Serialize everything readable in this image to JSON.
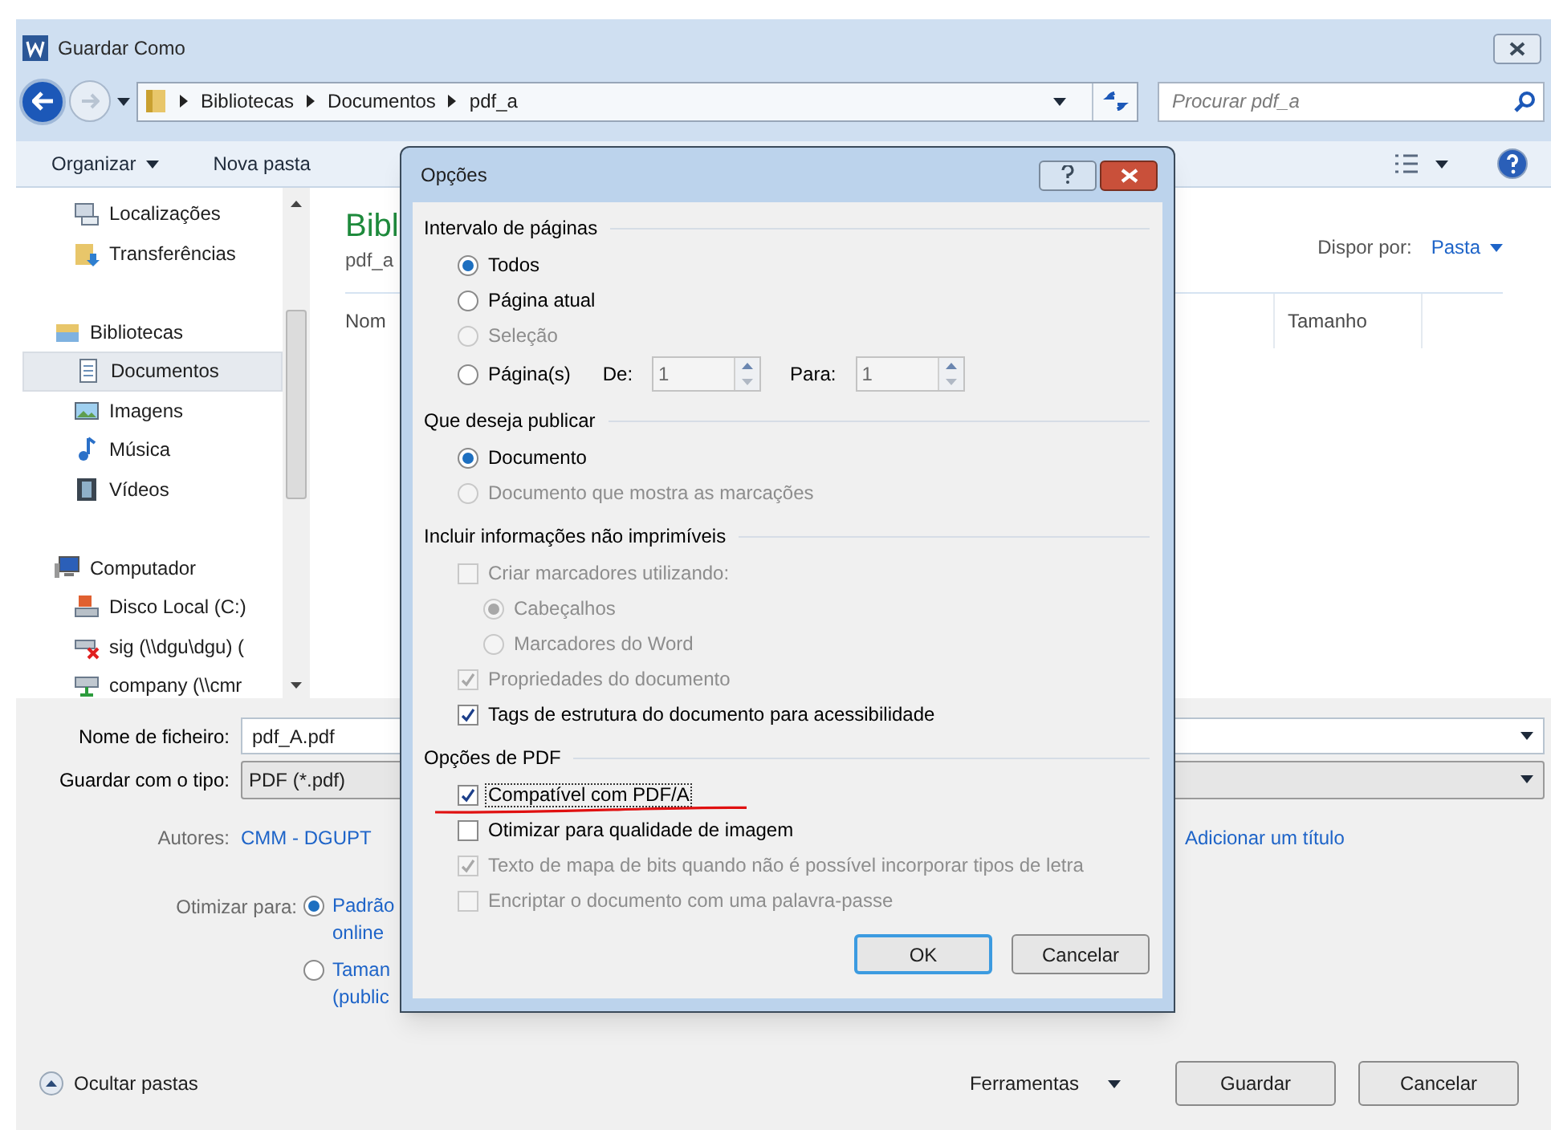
{
  "window": {
    "title": "Guardar Como"
  },
  "address_bar": {
    "path": [
      "Bibliotecas",
      "Documentos",
      "pdf_a"
    ]
  },
  "search": {
    "placeholder": "Procurar pdf_a"
  },
  "toolbar": {
    "organize": "Organizar",
    "new_folder": "Nova pasta"
  },
  "nav_pane": {
    "sections": [
      {
        "children": [
          {
            "label": "Localizações",
            "kind": "places",
            "selected": false
          },
          {
            "label": "Transferências",
            "kind": "downloads",
            "selected": false
          }
        ]
      },
      {
        "label": "Bibliotecas",
        "kind": "library",
        "selected": false,
        "children": [
          {
            "label": "Documentos",
            "kind": "documents",
            "selected": true
          },
          {
            "label": "Imagens",
            "kind": "images",
            "selected": false
          },
          {
            "label": "Música",
            "kind": "music",
            "selected": false
          },
          {
            "label": "Vídeos",
            "kind": "videos",
            "selected": false
          }
        ]
      },
      {
        "label": "Computador",
        "kind": "computer",
        "selected": false,
        "children": [
          {
            "label": "Disco Local (C:)",
            "kind": "disk",
            "selected": false
          },
          {
            "label": "sig (\\\\dgu\\dgu) (",
            "kind": "network-drive-error",
            "selected": false
          },
          {
            "label": "company (\\\\cmr",
            "kind": "network-drive",
            "selected": false
          }
        ]
      }
    ]
  },
  "library": {
    "title": "Bibl",
    "subtitle": "pdf_a",
    "arrange_label": "Dispor por:",
    "arrange_value": "Pasta",
    "columns": [
      "Nom",
      "Tamanho"
    ]
  },
  "form": {
    "file_name": {
      "label": "Nome de ficheiro:",
      "value": "pdf_A.pdf"
    },
    "file_type": {
      "label": "Guardar com o tipo:",
      "value": "PDF (*.pdf)"
    },
    "authors": {
      "label": "Autores:",
      "value": "CMM - DGUPT"
    },
    "title_link": "Adicionar um título",
    "optimize": {
      "label": "Otimizar para:",
      "options": [
        {
          "lines": [
            "Padrão",
            "online"
          ],
          "selected": true
        },
        {
          "lines": [
            "Taman",
            "(public"
          ],
          "selected": false
        }
      ]
    }
  },
  "footer": {
    "hide_folders": "Ocultar pastas",
    "tools": "Ferramentas",
    "buttons": [
      {
        "label": "Guardar"
      },
      {
        "label": "Cancelar"
      }
    ]
  },
  "dialog": {
    "title": "Opções",
    "sections": [
      {
        "title": "Intervalo de páginas",
        "items": [
          {
            "kind": "radio",
            "label": "Todos",
            "selected": true,
            "disabled": false
          },
          {
            "kind": "radio",
            "label": "Página atual",
            "selected": false,
            "disabled": false
          },
          {
            "kind": "radio",
            "label": "Seleção",
            "selected": false,
            "disabled": true
          },
          {
            "kind": "range",
            "label": "Página(s)",
            "selected": false,
            "disabled": false,
            "from": {
              "label": "De:",
              "value": "1"
            },
            "to": {
              "label": "Para:",
              "value": "1"
            }
          }
        ]
      },
      {
        "title": "Que deseja publicar",
        "items": [
          {
            "kind": "radio",
            "label": "Documento",
            "selected": true,
            "disabled": false
          },
          {
            "kind": "radio",
            "label": "Documento que mostra as marcações",
            "selected": false,
            "disabled": true
          }
        ]
      },
      {
        "title": "Incluir informações não imprimíveis",
        "items": [
          {
            "kind": "checkbox",
            "label": "Criar marcadores utilizando:",
            "checked": false,
            "disabled": true,
            "children": [
              {
                "kind": "radio",
                "label": "Cabeçalhos",
                "selected": true,
                "disabled": true
              },
              {
                "kind": "radio",
                "label": "Marcadores do Word",
                "selected": false,
                "disabled": true
              }
            ]
          },
          {
            "kind": "checkbox",
            "label": "Propriedades do documento",
            "checked": true,
            "disabled": true
          },
          {
            "kind": "checkbox",
            "label": "Tags de estrutura do documento para acessibilidade",
            "checked": true,
            "disabled": false
          }
        ]
      },
      {
        "title": "Opções de PDF",
        "items": [
          {
            "kind": "checkbox",
            "label": "Compatível com PDF/A",
            "checked": true,
            "disabled": false,
            "focused": true
          },
          {
            "kind": "checkbox",
            "label": "Otimizar para qualidade de imagem",
            "checked": false,
            "disabled": false,
            "focused": false
          },
          {
            "kind": "checkbox",
            "label": "Texto de mapa de bits quando não é possível incorporar tipos de letra",
            "checked": true,
            "disabled": true,
            "focused": false
          },
          {
            "kind": "checkbox",
            "label": "Encriptar o documento com uma palavra-passe",
            "checked": false,
            "disabled": true,
            "focused": false
          }
        ]
      }
    ],
    "buttons": [
      {
        "label": "OK",
        "default": true
      },
      {
        "label": "Cancelar",
        "default": false
      }
    ]
  }
}
